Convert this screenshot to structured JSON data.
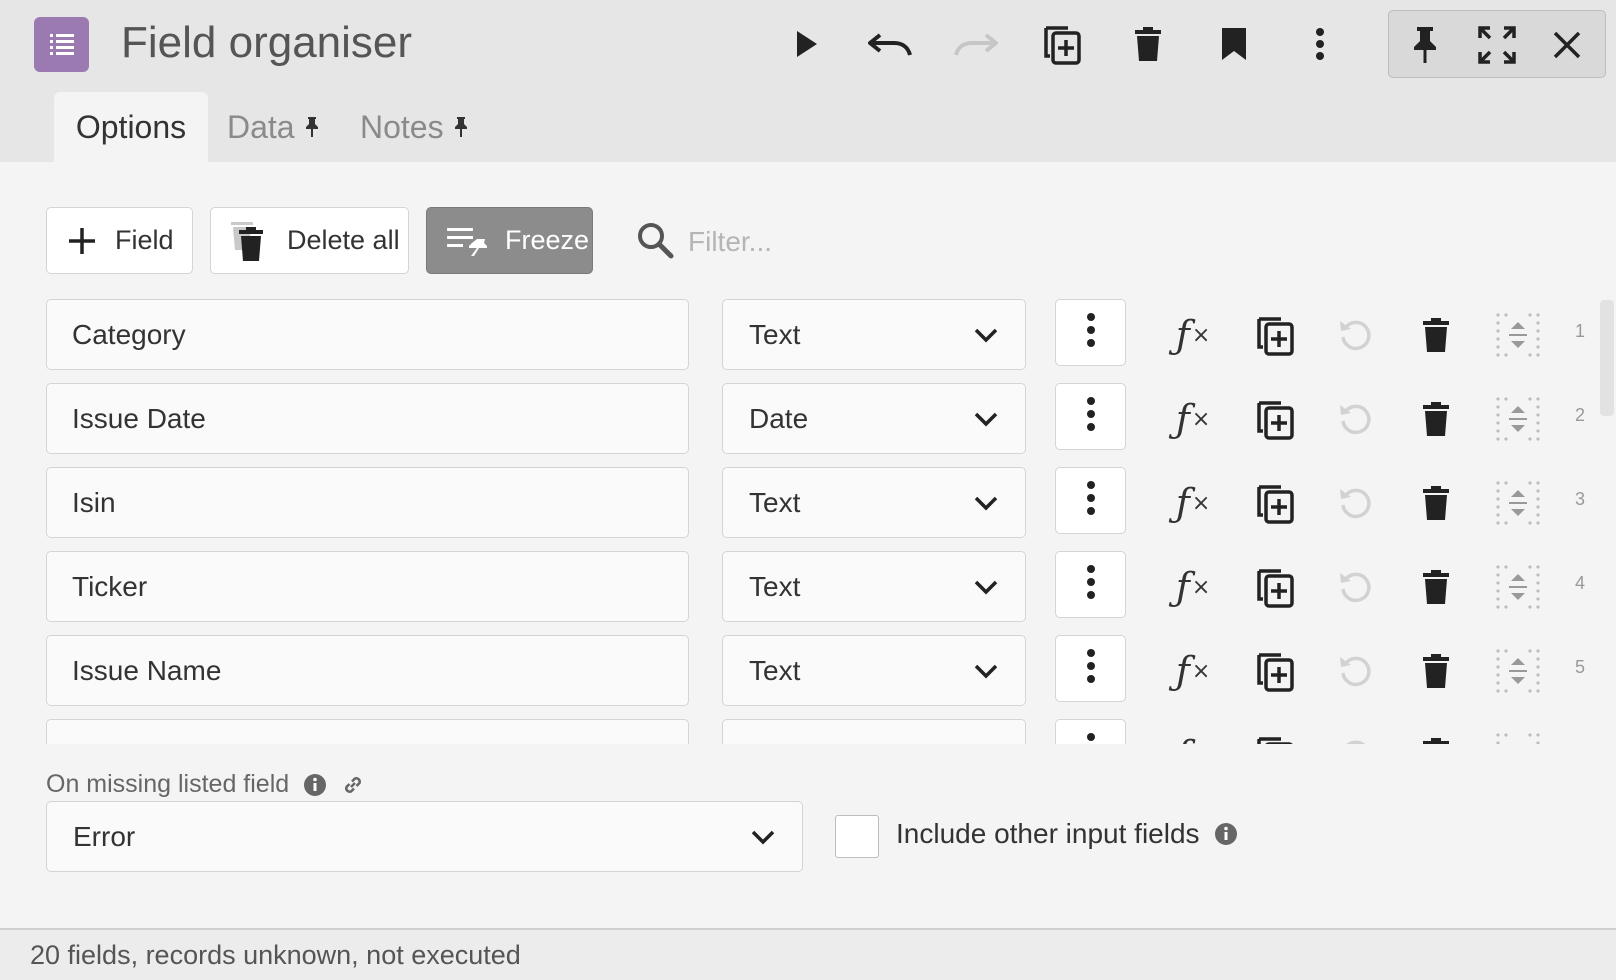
{
  "app": {
    "title": "Field organiser",
    "icon": "list-icon",
    "accent_color": "#9b7ab2"
  },
  "toolbar": {
    "run": "play-icon",
    "undo": "undo-icon",
    "redo": "redo-icon",
    "duplicate": "duplicate-icon",
    "delete": "trash-icon",
    "bookmark": "bookmark-icon",
    "more": "more-vertical-icon",
    "pin": "pin-icon",
    "maximize": "maximize-icon",
    "close": "close-icon"
  },
  "tabs": [
    {
      "label": "Options",
      "active": true
    },
    {
      "label": "Data",
      "pinned": true
    },
    {
      "label": "Notes",
      "pinned": true
    }
  ],
  "actions": {
    "add_field": "Field",
    "delete_all": "Delete all",
    "freeze": "Freeze",
    "filter_placeholder": "Filter..."
  },
  "fields": [
    {
      "name": "Category",
      "type": "Text",
      "index": "1"
    },
    {
      "name": "Issue Date",
      "type": "Date",
      "index": "2"
    },
    {
      "name": "Isin",
      "type": "Text",
      "index": "3"
    },
    {
      "name": "Ticker",
      "type": "Text",
      "index": "4"
    },
    {
      "name": "Issue Name",
      "type": "Text",
      "index": "5"
    },
    {
      "name": "",
      "type": "",
      "index": ""
    }
  ],
  "options": {
    "missing_label": "On missing listed field",
    "missing_value": "Error",
    "include_other_label": "Include other input fields",
    "include_other_checked": false
  },
  "status": {
    "text": "20 fields, records unknown, not executed"
  }
}
